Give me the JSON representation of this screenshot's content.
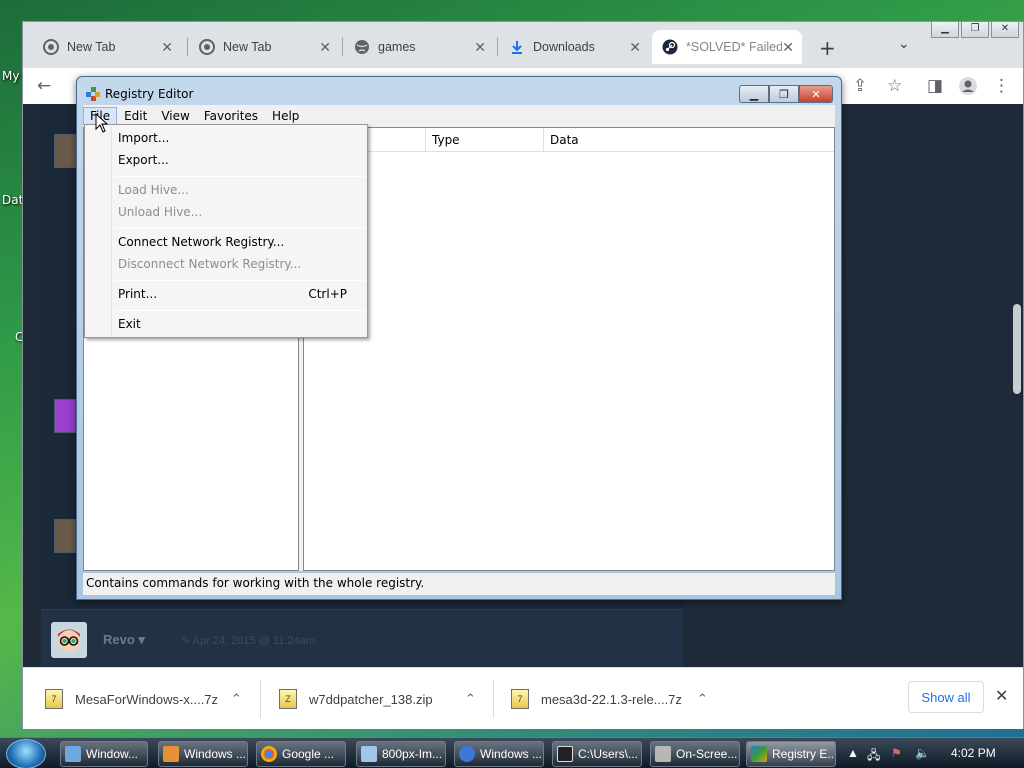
{
  "desktop": {
    "label_top": "My",
    "label_mid": "Dat",
    "label_low": "C"
  },
  "browser": {
    "tabs": [
      {
        "label": "New Tab",
        "icon": "chrome-icon"
      },
      {
        "label": "New Tab",
        "icon": "chrome-icon"
      },
      {
        "label": "games",
        "icon": "globe-icon"
      },
      {
        "label": "Downloads",
        "icon": "download-icon"
      },
      {
        "label": "*SOLVED* Failed",
        "icon": "steam-icon"
      }
    ],
    "forum": {
      "username": "Revo",
      "date": "Apr 24, 2015 @ 11:24am"
    },
    "downloads": [
      {
        "name": "MesaForWindows-x....7z"
      },
      {
        "name": "w7ddpatcher_138.zip"
      },
      {
        "name": "mesa3d-22.1.3-rele....7z"
      }
    ],
    "show_all": "Show all"
  },
  "regedit": {
    "title": "Registry Editor",
    "menus": [
      "File",
      "Edit",
      "View",
      "Favorites",
      "Help"
    ],
    "columns": [
      "Type",
      "Data"
    ],
    "status": "Contains commands for working with the whole registry.",
    "file_menu": {
      "import": "Import...",
      "export": "Export...",
      "load_hive": "Load Hive...",
      "unload_hive": "Unload Hive...",
      "connect": "Connect Network Registry...",
      "disconnect": "Disconnect Network Registry...",
      "print": "Print...",
      "print_shortcut": "Ctrl+P",
      "exit": "Exit"
    }
  },
  "taskbar": {
    "buttons": [
      {
        "label": "Window..."
      },
      {
        "label": "Windows ..."
      },
      {
        "label": "Google ..."
      },
      {
        "label": "800px-Im..."
      },
      {
        "label": "Windows ..."
      },
      {
        "label": "C:\\Users\\..."
      },
      {
        "label": "On-Scree..."
      },
      {
        "label": "Registry E..."
      }
    ],
    "clock": "4:02 PM"
  },
  "colors": {
    "accent": "#1a73e8",
    "steam_bg": "#1b2838",
    "taskbar": "#1a2633"
  }
}
